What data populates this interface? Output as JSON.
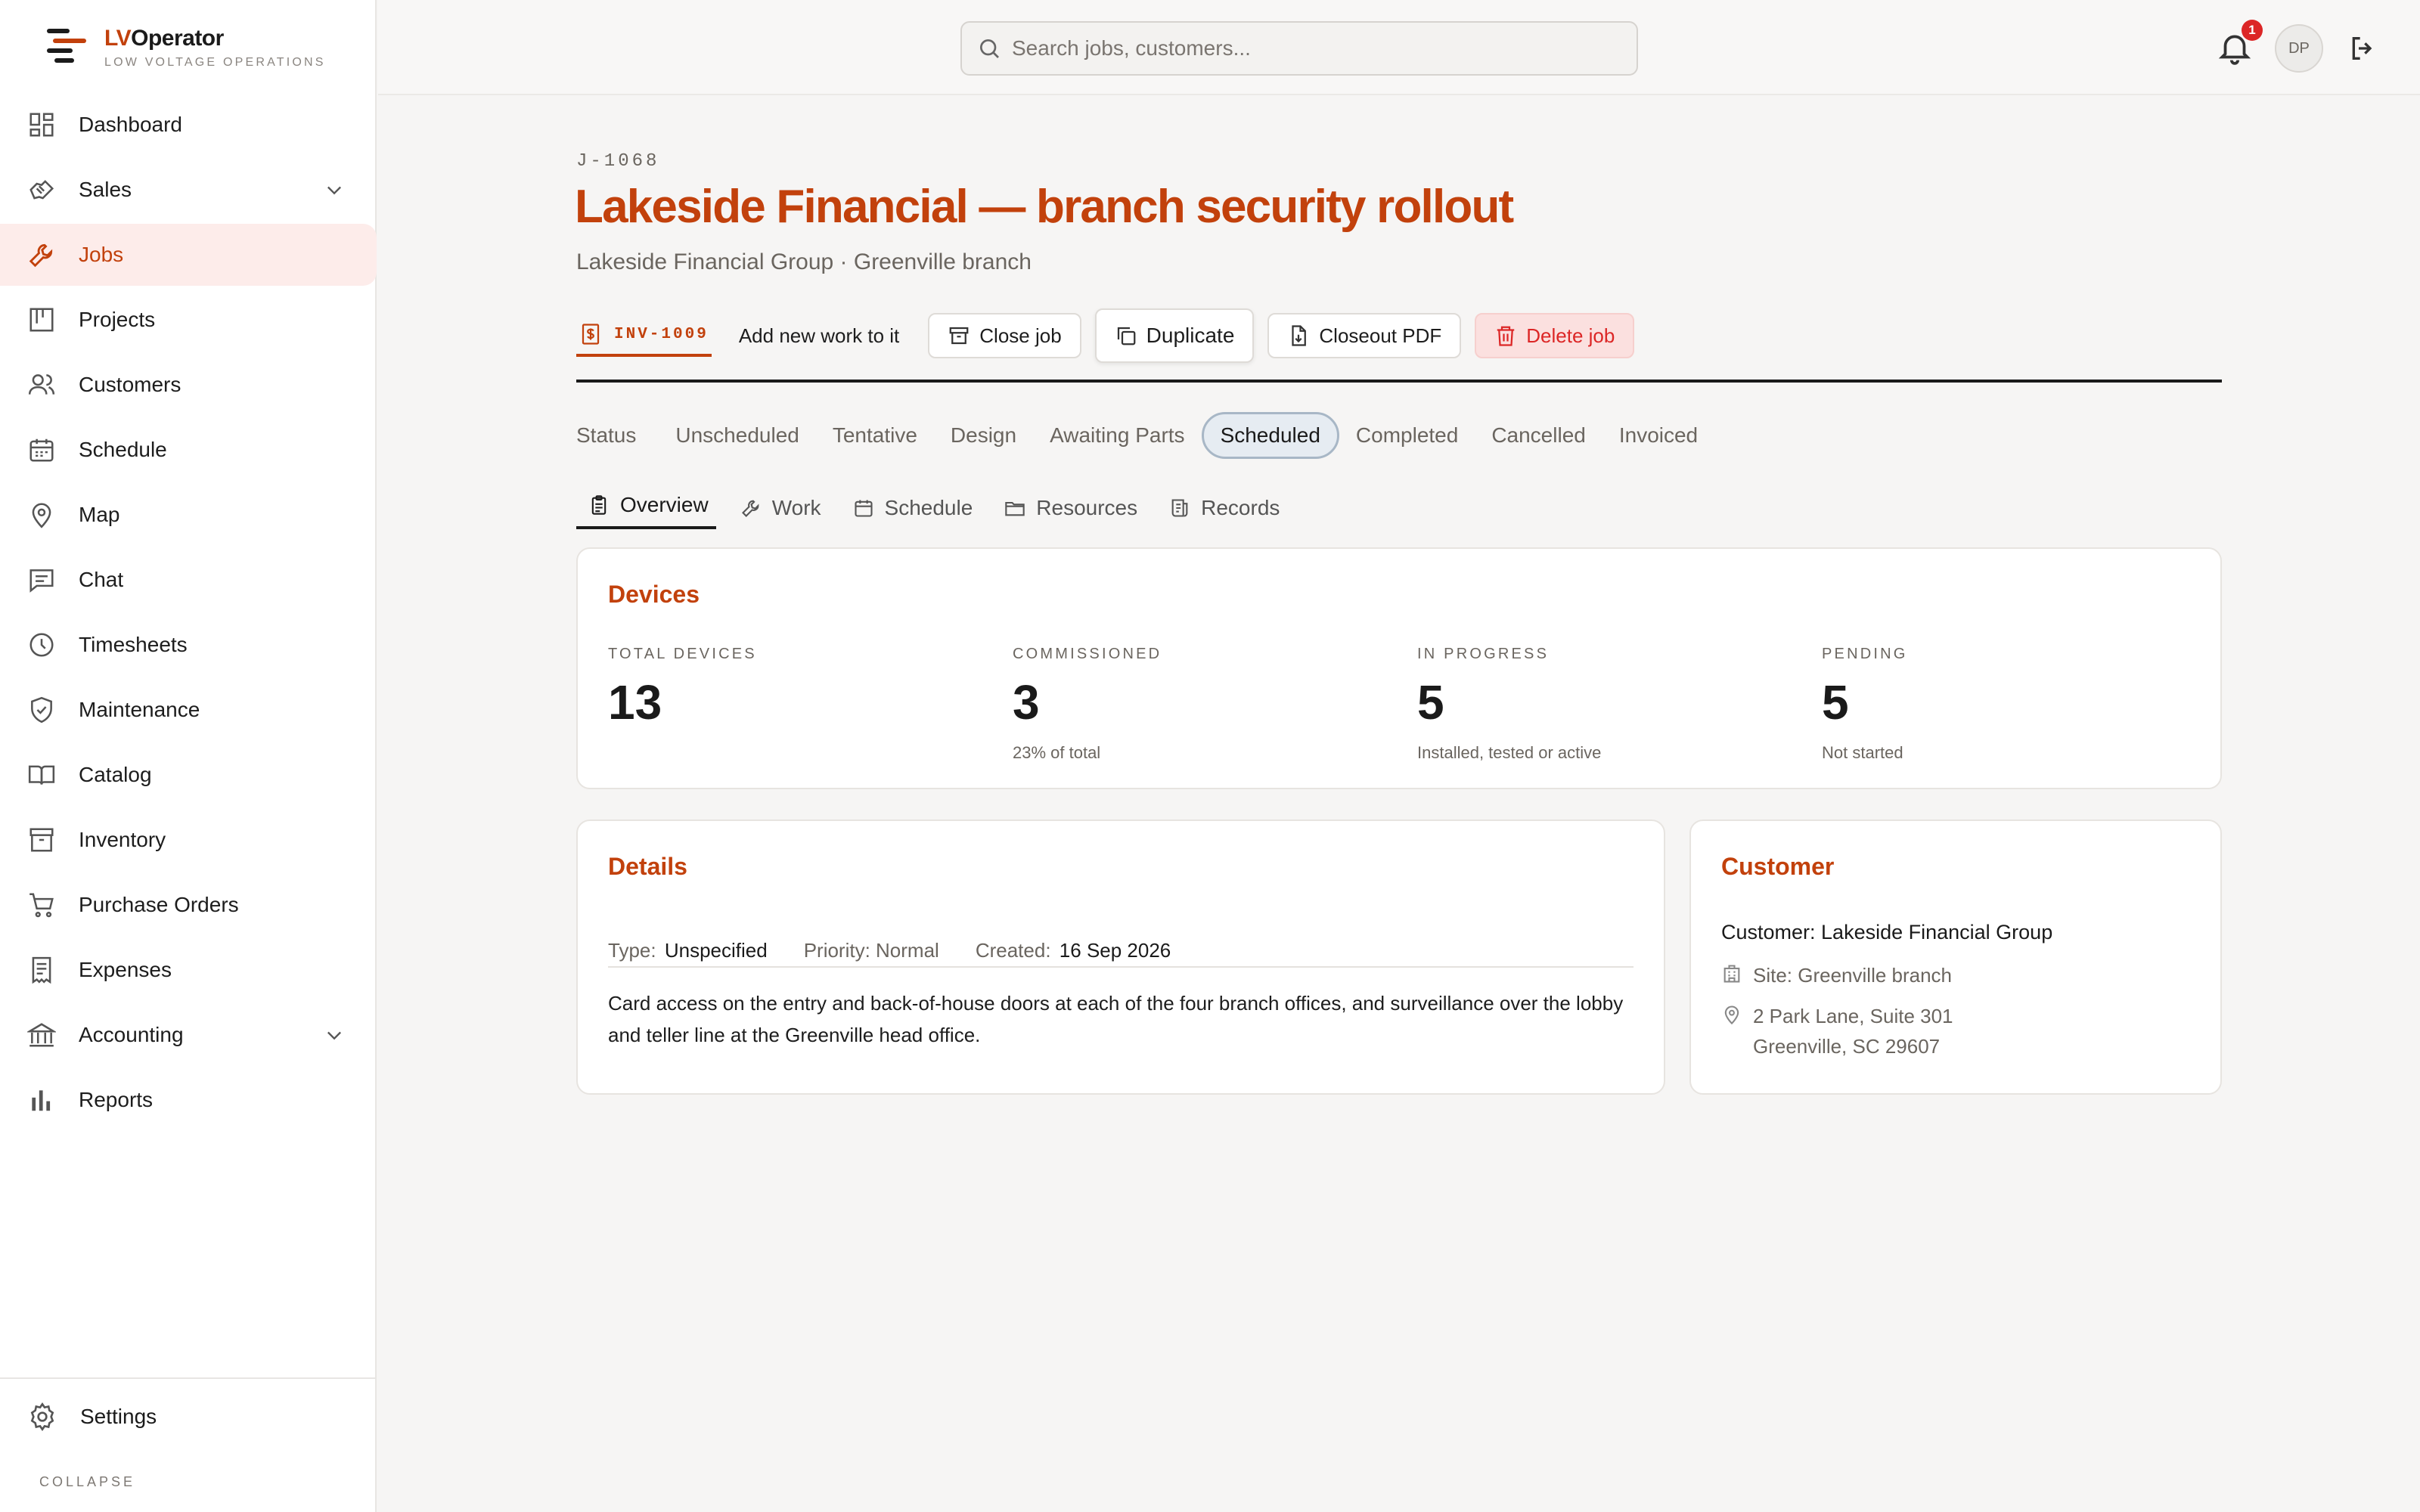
{
  "brand": {
    "name_prefix": "LV",
    "name_rest": "Operator",
    "tagline": "LOW VOLTAGE OPERATIONS"
  },
  "sidebar": {
    "items": [
      {
        "label": "Dashboard",
        "icon": "dashboard-icon"
      },
      {
        "label": "Sales",
        "icon": "handshake-icon",
        "expandable": true
      },
      {
        "label": "Jobs",
        "icon": "wrench-icon",
        "active": true
      },
      {
        "label": "Projects",
        "icon": "kanban-icon"
      },
      {
        "label": "Customers",
        "icon": "users-icon"
      },
      {
        "label": "Schedule",
        "icon": "calendar-icon"
      },
      {
        "label": "Map",
        "icon": "map-pin-icon"
      },
      {
        "label": "Chat",
        "icon": "chat-icon"
      },
      {
        "label": "Timesheets",
        "icon": "clock-icon"
      },
      {
        "label": "Maintenance",
        "icon": "shield-check-icon"
      },
      {
        "label": "Catalog",
        "icon": "book-icon"
      },
      {
        "label": "Inventory",
        "icon": "archive-box-icon"
      },
      {
        "label": "Purchase Orders",
        "icon": "cart-icon"
      },
      {
        "label": "Expenses",
        "icon": "receipt-icon"
      },
      {
        "label": "Accounting",
        "icon": "bank-icon",
        "expandable": true
      },
      {
        "label": "Reports",
        "icon": "bar-chart-icon"
      }
    ],
    "settings_label": "Settings",
    "collapse_label": "COLLAPSE"
  },
  "topbar": {
    "search_placeholder": "Search jobs, customers...",
    "notification_count": "1",
    "avatar_initials": "DP"
  },
  "job": {
    "code": "J-1068",
    "title": "Lakeside Financial — branch security rollout",
    "subtitle": "Lakeside Financial Group · Greenville branch",
    "invoice_label": "INV-1009",
    "add_work_label": "Add new work to it",
    "buttons": {
      "close": "Close job",
      "duplicate": "Duplicate",
      "closeout": "Closeout PDF",
      "delete": "Delete job"
    }
  },
  "status": {
    "label": "Status",
    "options": [
      "Unscheduled",
      "Tentative",
      "Design",
      "Awaiting Parts",
      "Scheduled",
      "Completed",
      "Cancelled",
      "Invoiced"
    ],
    "selected": "Scheduled"
  },
  "tabs": [
    {
      "label": "Overview",
      "icon": "clipboard-icon",
      "active": true
    },
    {
      "label": "Work",
      "icon": "wrench-icon"
    },
    {
      "label": "Schedule",
      "icon": "calendar-icon"
    },
    {
      "label": "Resources",
      "icon": "folder-icon"
    },
    {
      "label": "Records",
      "icon": "records-icon"
    }
  ],
  "devices": {
    "title": "Devices",
    "stats": [
      {
        "label": "TOTAL DEVICES",
        "value": "13",
        "note": ""
      },
      {
        "label": "COMMISSIONED",
        "value": "3",
        "note": "23% of total"
      },
      {
        "label": "IN PROGRESS",
        "value": "5",
        "note": "Installed, tested or active"
      },
      {
        "label": "PENDING",
        "value": "5",
        "note": "Not started"
      }
    ]
  },
  "details": {
    "title": "Details",
    "type_label": "Type:",
    "type_value": "Unspecified",
    "priority_label": "Priority: Normal",
    "created_label": "Created:",
    "created_value": "16 Sep 2026",
    "description": "Card access on the entry and back-of-house doors at each of the four branch offices, and surveillance over the lobby and teller line at the Greenville head office."
  },
  "customer": {
    "title": "Customer",
    "name": "Customer: Lakeside Financial Group",
    "site": "Site: Greenville branch",
    "address_line1": "2 Park Lane, Suite 301",
    "address_line2": "Greenville, SC 29607"
  },
  "colors": {
    "accent": "#c2410c",
    "active_bg": "#fdecea",
    "danger": "#dc2626",
    "status_active_bg": "#e6ecf2"
  }
}
